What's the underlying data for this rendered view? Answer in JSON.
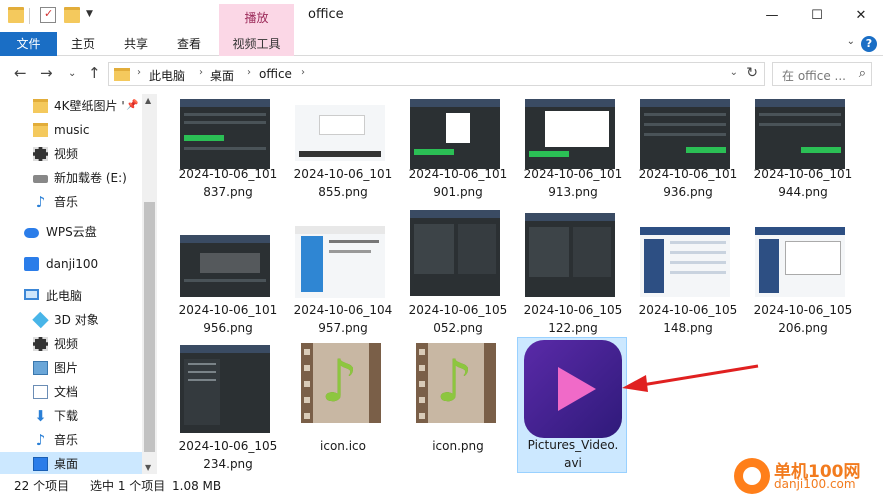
{
  "titlebar": {
    "context_tab": "播放",
    "title": "office",
    "min_label": "—",
    "max_label": "☐",
    "close_label": "✕"
  },
  "ribbon": {
    "tabs": [
      {
        "label": "文件"
      },
      {
        "label": "主页"
      },
      {
        "label": "共享"
      },
      {
        "label": "查看"
      },
      {
        "label": "视频工具"
      }
    ]
  },
  "address": {
    "crumbs": [
      "此电脑",
      "桌面",
      "office"
    ],
    "search_placeholder": "在 office ..."
  },
  "sidebar": {
    "items": [
      {
        "label": "4K壁纸图片 '"
      },
      {
        "label": "music"
      },
      {
        "label": "视频"
      },
      {
        "label": "新加载卷 (E:)"
      },
      {
        "label": "音乐"
      },
      {
        "label": "WPS云盘"
      },
      {
        "label": "danji100"
      },
      {
        "label": "此电脑"
      },
      {
        "label": "3D 对象"
      },
      {
        "label": "视频"
      },
      {
        "label": "图片"
      },
      {
        "label": "文档"
      },
      {
        "label": "下载"
      },
      {
        "label": "音乐"
      },
      {
        "label": "桌面"
      }
    ]
  },
  "files": [
    {
      "line1": "2024-10-06_101",
      "line2": "837.png"
    },
    {
      "line1": "2024-10-06_101",
      "line2": "855.png"
    },
    {
      "line1": "2024-10-06_101",
      "line2": "901.png"
    },
    {
      "line1": "2024-10-06_101",
      "line2": "913.png"
    },
    {
      "line1": "2024-10-06_101",
      "line2": "936.png"
    },
    {
      "line1": "2024-10-06_101",
      "line2": "944.png"
    },
    {
      "line1": "2024-10-06_101",
      "line2": "956.png"
    },
    {
      "line1": "2024-10-06_104",
      "line2": "957.png"
    },
    {
      "line1": "2024-10-06_105",
      "line2": "052.png"
    },
    {
      "line1": "2024-10-06_105",
      "line2": "122.png"
    },
    {
      "line1": "2024-10-06_105",
      "line2": "148.png"
    },
    {
      "line1": "2024-10-06_105",
      "line2": "206.png"
    },
    {
      "line1": "2024-10-06_105",
      "line2": "234.png"
    },
    {
      "line1": "icon.ico",
      "line2": ""
    },
    {
      "line1": "icon.png",
      "line2": ""
    },
    {
      "line1": "Pictures_Video.",
      "line2": "avi"
    }
  ],
  "status": {
    "count": "22 个项目",
    "selected": "选中 1 个项目",
    "size": "1.08 MB"
  },
  "watermark": {
    "text": "单机100网",
    "sub": "danji100.com"
  },
  "colors": {
    "accent": "#1a6ec5",
    "context_tab_bg": "#fbd7e6",
    "selection": "#cce8ff",
    "arrow": "#e02020"
  }
}
